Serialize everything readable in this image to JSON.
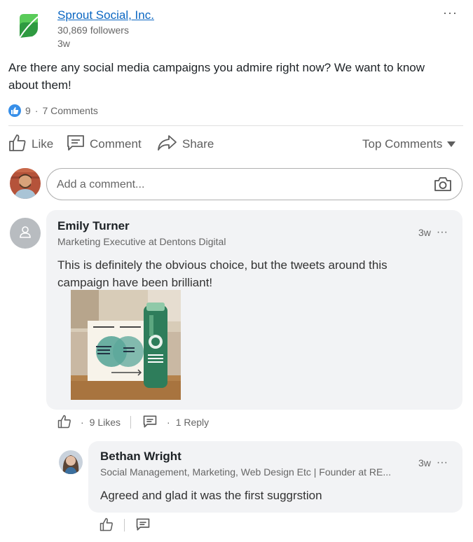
{
  "post": {
    "company": "Sprout Social, Inc.",
    "followers": "30,869 followers",
    "age": "3w",
    "more": "···",
    "text": "Are there any social media campaigns you admire right now? We want to know about them!",
    "likes_count": "9",
    "dot": "·",
    "comments_count": "7 Comments"
  },
  "actions": {
    "like": "Like",
    "comment": "Comment",
    "share": "Share",
    "sort": "Top Comments"
  },
  "composer": {
    "placeholder": "Add a comment..."
  },
  "comments": [
    {
      "author": "Emily Turner",
      "headline": "Marketing Executive at Dentons Digital",
      "time": "3w",
      "more": "···",
      "text": "This is definitely the obvious choice, but the tweets around this campaign have been brilliant!",
      "dot": "·",
      "likes": "9 Likes",
      "replies": "1 Reply"
    },
    {
      "author": "Bethan Wright",
      "headline": "Social Management, Marketing, Web Design Etc | Founder at RE...",
      "time": "3w",
      "more": "···",
      "text": "Agreed and glad it was the first suggrstion"
    }
  ],
  "colors": {
    "link": "#0a66c2",
    "like_badge": "#378fe9",
    "bubble": "#f2f3f5",
    "brand_green": "#59cb59"
  },
  "icons": [
    "sprout-logo-icon",
    "more-icon",
    "like-badge-icon",
    "like-icon",
    "comment-icon",
    "share-icon",
    "caret-down-icon",
    "camera-icon",
    "person-icon"
  ]
}
